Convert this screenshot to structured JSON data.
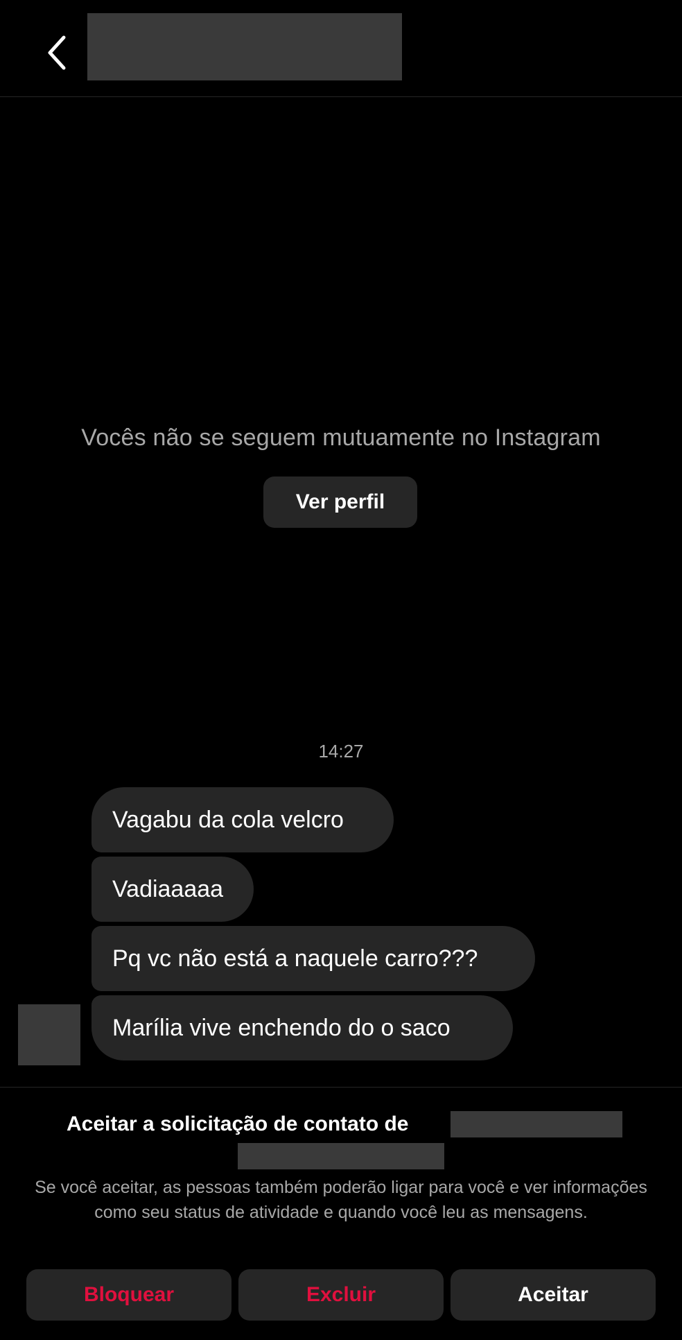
{
  "header": {
    "back_icon": "chevron-left-icon"
  },
  "profile_notice": {
    "mutual_text": "Vocês não se seguem mutuamente no Instagram",
    "view_profile_label": "Ver perfil"
  },
  "conversation": {
    "timestamp": "14:27",
    "messages": [
      {
        "text": "Vagabu da cola velcro"
      },
      {
        "text": "Vadiaaaaa"
      },
      {
        "text": "Pq vc não está a naquele carro???"
      },
      {
        "text": "Marília vive enchendo do o saco"
      }
    ]
  },
  "request": {
    "title": "Aceitar a solicitação de contato de",
    "description": "Se você aceitar, as pessoas também poderão ligar para você e ver informações como seu status de atividade e quando você leu as mensagens."
  },
  "actions": {
    "block_label": "Bloquear",
    "delete_label": "Excluir",
    "accept_label": "Aceitar"
  },
  "colors": {
    "background": "#000000",
    "surface": "#262626",
    "secondary_text": "#a8a8a8",
    "danger": "#e0103e",
    "redaction": "#3a3a3a"
  }
}
